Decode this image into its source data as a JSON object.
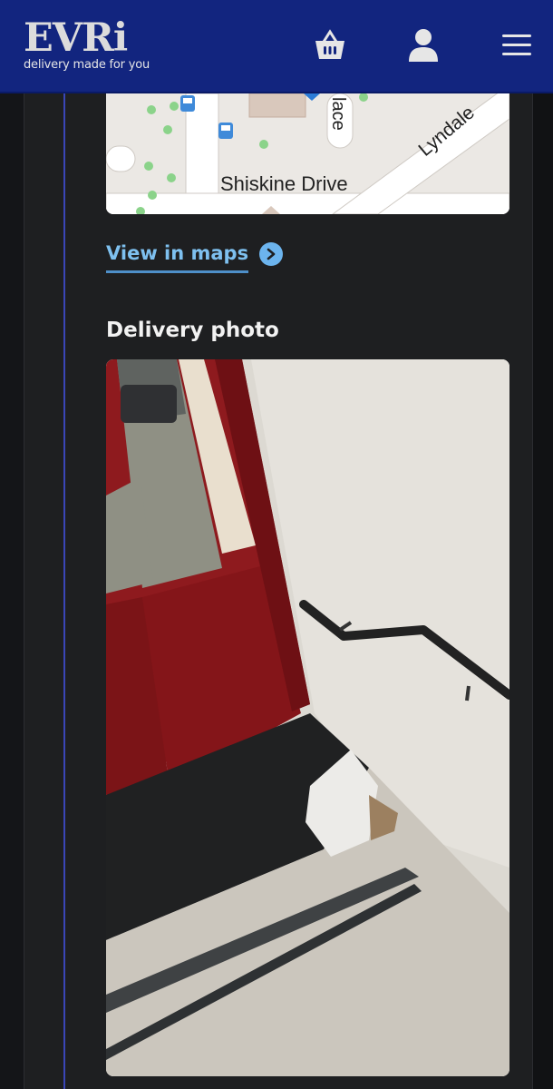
{
  "header": {
    "logo_word": "EVRi",
    "logo_tagline": "delivery made for you",
    "icons": [
      "basket-icon",
      "account-icon",
      "menu-icon"
    ]
  },
  "map": {
    "labels": {
      "street_1": "Shiskine Drive",
      "street_2": "Lyndale",
      "street_3": "lace"
    }
  },
  "link": {
    "view_in_maps": "View in maps"
  },
  "delivery_photo": {
    "title": "Delivery photo"
  },
  "colors": {
    "header_bg": "#12257f",
    "link": "#7ec0ef",
    "page_bg": "#1e1f21",
    "door_red": "#8e1a1e"
  }
}
